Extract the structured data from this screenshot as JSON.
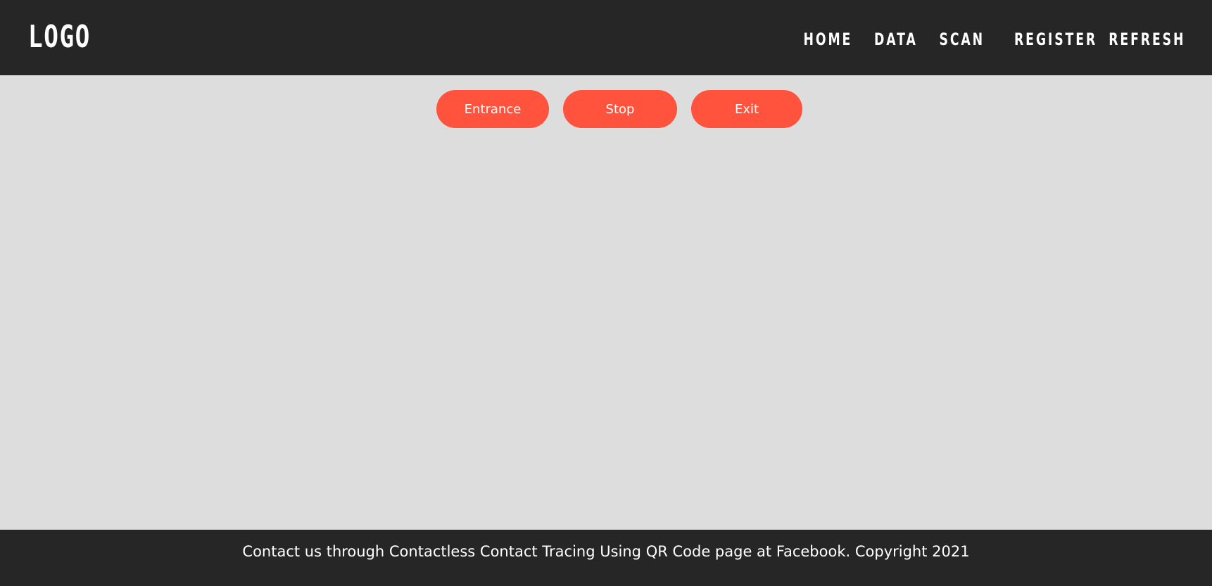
{
  "header": {
    "logo": "LOGO",
    "nav": {
      "home": "HOME",
      "data": "DATA",
      "scan": "SCAN",
      "register": "REGISTER",
      "refresh": "REFRESH"
    }
  },
  "controls": {
    "entrance": "Entrance",
    "stop": "Stop",
    "exit": "Exit"
  },
  "footer": {
    "text": "Contact us through Contactless Contact Tracing Using QR Code page at Facebook. Copyright 2021"
  },
  "colors": {
    "header_bg": "#262626",
    "page_bg": "#dddddd",
    "accent": "#ff533d",
    "text_light": "#ffffff"
  }
}
